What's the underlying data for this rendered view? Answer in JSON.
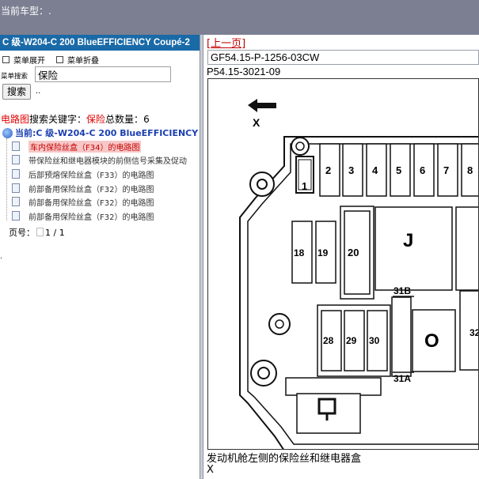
{
  "topbar": {
    "car_label": "当前车型：."
  },
  "left": {
    "model_header": "C 级-W204-C 200 BlueEFFICIENCY Coupé-2",
    "menu_expand": "菜单展开",
    "menu_collapse": "菜单折叠",
    "search_label": "菜单搜索",
    "search_value": "保险",
    "search_button": "搜索",
    "search_dots": "..",
    "results": {
      "prefix": "电路图",
      "mid": "搜索关键字：",
      "keyword": "保险",
      "suffix": "总数量：",
      "count": "6"
    },
    "tree_current": "当前:C 级-W204-C 200 BlueEFFICIENCY",
    "items": [
      "车内保险丝盒（F34）的电路图",
      "带保险丝和继电器模块的前侧信号采集及促动",
      "后部预熔保险丝盒（F33）的电路图",
      "前部备用保险丝盒（F32）的电路图",
      "前部备用保险丝盒（F32）的电路图",
      "前部备用保险丝盒（F32）的电路图"
    ],
    "pager_label": "页号：",
    "pager_value": "1 / 1",
    "bottom_dot": "."
  },
  "right": {
    "prev_page": "[上一页]",
    "code1": "GF54.15-P-1256-03CW",
    "code2": "P54.15-3021-09",
    "caption": "发动机舱左侧的保险丝和继电器盒",
    "caption2": "X",
    "diagram": {
      "x_label": "X",
      "fuses": [
        "1",
        "2",
        "3",
        "4",
        "5",
        "6",
        "7",
        "8",
        "18",
        "19",
        "20",
        "28",
        "29",
        "30",
        "32"
      ],
      "labels": [
        "J",
        "O",
        "31B",
        "31A"
      ]
    }
  }
}
